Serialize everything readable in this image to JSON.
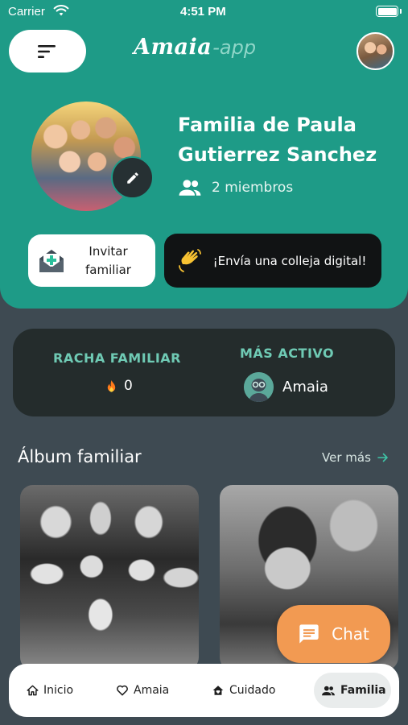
{
  "status_bar": {
    "carrier": "Carrier",
    "time": "4:51 PM"
  },
  "header": {
    "logo_main": "Amaia",
    "logo_suffix": "-app",
    "family_name": "Familia de Paula Gutierrez Sanchez",
    "members": "2 miembros"
  },
  "actions": {
    "invite_label": "Invitar familiar",
    "colleja_label": "¡Envía una colleja digital!"
  },
  "stats": {
    "streak_title": "RACHA FAMILIAR",
    "streak_value": "0",
    "active_title": "MÁS ACTIVO",
    "active_name": "Amaia"
  },
  "album": {
    "title": "Álbum familiar",
    "see_more": "Ver más"
  },
  "chat": {
    "label": "Chat"
  },
  "nav": {
    "items": [
      {
        "label": "Inicio",
        "icon": "home-icon"
      },
      {
        "label": "Amaia",
        "icon": "heart-icon"
      },
      {
        "label": "Cuidado",
        "icon": "home-heart-icon"
      },
      {
        "label": "Familia",
        "icon": "group-icon",
        "active": true
      }
    ]
  },
  "colors": {
    "primary": "#1e9b87",
    "background": "#3e4a52",
    "card": "#242c2c",
    "accent_text": "#6fcab4",
    "chat_button": "#f29a52"
  }
}
